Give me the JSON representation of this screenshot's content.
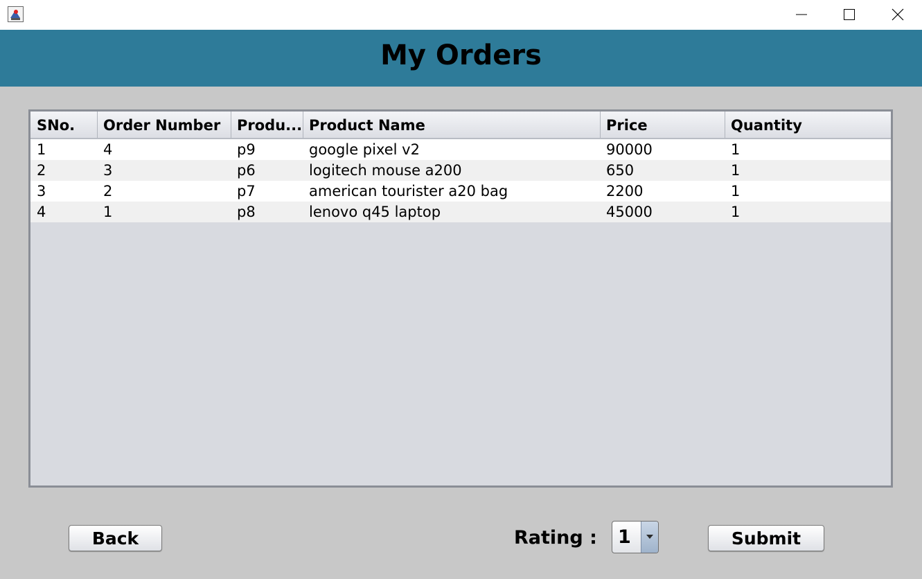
{
  "window": {
    "app_icon": "java-icon",
    "controls": [
      "minimize-icon",
      "maximize-icon",
      "close-icon"
    ]
  },
  "header": {
    "title": "My Orders",
    "background": "#2e7b99"
  },
  "table": {
    "columns": [
      "SNo.",
      "Order Number",
      "Produ...",
      "Product Name",
      "Price",
      "Quantity"
    ],
    "rows": [
      [
        "1",
        "4",
        "p9",
        "google pixel v2",
        "90000",
        "1"
      ],
      [
        "2",
        "3",
        "p6",
        "logitech mouse a200",
        "650",
        "1"
      ],
      [
        "3",
        "2",
        "p7",
        "american tourister a20 bag",
        "2200",
        "1"
      ],
      [
        "4",
        "1",
        "p8",
        "lenovo q45 laptop",
        "45000",
        "1"
      ]
    ]
  },
  "footer": {
    "back_label": "Back",
    "rating_label": "Rating :",
    "rating_value": "1",
    "submit_label": "Submit"
  }
}
